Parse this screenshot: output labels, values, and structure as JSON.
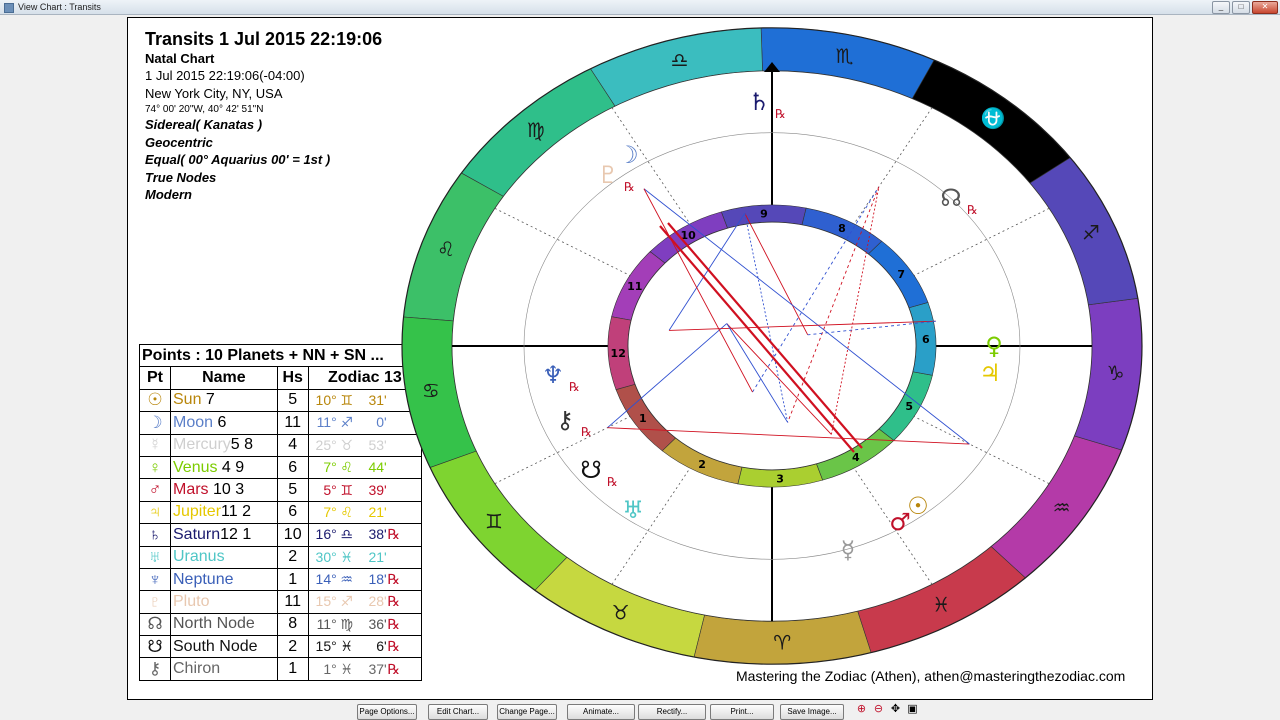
{
  "window": {
    "title": "View Chart : Transits"
  },
  "header": {
    "title": "Transits 1 Jul 2015 22:19:06",
    "chart_type": "Natal Chart",
    "datetime": "1 Jul 2015 22:19:06(-04:00)",
    "location": "New York City, NY, USA",
    "coords": "74° 00' 20\"W, 40° 42' 51\"N",
    "zodiac": "Sidereal( Kanatas )",
    "perspective": "Geocentric",
    "house_system": "Equal( 00° Aquarius 00' = 1st )",
    "nodes": "True Nodes",
    "style": "Modern"
  },
  "table": {
    "caption": "Points : 10 Planets + NN + SN ...",
    "headers": [
      "Pt",
      "Name",
      "Hs",
      "Zodiac 13"
    ],
    "rows": [
      {
        "glyph": "☉",
        "name": "Sun",
        "aspect": " 7",
        "hs": "5",
        "deg": "10°",
        "sign": "♊",
        "min": "31'",
        "rx": "",
        "color": "#b8860b"
      },
      {
        "glyph": "☽",
        "name": "Moon",
        "aspect": " 6",
        "hs": "11",
        "deg": "11°",
        "sign": "♐",
        "min": "0'",
        "rx": "",
        "color": "#5b7fc8"
      },
      {
        "glyph": "☿",
        "name": "Mercury",
        "aspect": "5 8",
        "hs": "4",
        "deg": "25°",
        "sign": "♉",
        "min": "53'",
        "rx": "",
        "color": "#cfcfcf"
      },
      {
        "glyph": "♀",
        "name": "Venus",
        "aspect": " 4  9",
        "hs": "6",
        "deg": "7°",
        "sign": "♌",
        "min": "44'",
        "rx": "",
        "color": "#7ccc00"
      },
      {
        "glyph": "♂",
        "name": "Mars",
        "aspect": " 10 3",
        "hs": "5",
        "deg": "5°",
        "sign": "♊",
        "min": "39'",
        "rx": "",
        "color": "#c0102a"
      },
      {
        "glyph": "♃",
        "name": "Jupiter",
        "aspect": "11 2",
        "hs": "6",
        "deg": "7°",
        "sign": "♌",
        "min": "21'",
        "rx": "",
        "color": "#e5c800"
      },
      {
        "glyph": "♄",
        "name": "Saturn",
        "aspect": "12 1",
        "hs": "10",
        "deg": "16°",
        "sign": "♎",
        "min": "38'",
        "rx": "℞",
        "color": "#1a1a6e"
      },
      {
        "glyph": "♅",
        "name": "Uranus",
        "aspect": "",
        "hs": "2",
        "deg": "30°",
        "sign": "♓",
        "min": "21'",
        "rx": "",
        "color": "#4fc6c6"
      },
      {
        "glyph": "♆",
        "name": "Neptune",
        "aspect": "",
        "hs": "1",
        "deg": "14°",
        "sign": "♒",
        "min": "18'",
        "rx": "℞",
        "color": "#3a5fb8"
      },
      {
        "glyph": "♇",
        "name": "Pluto",
        "aspect": "",
        "hs": "11",
        "deg": "15°",
        "sign": "♐",
        "min": "28'",
        "rx": "℞",
        "color": "#e8c8b0"
      },
      {
        "glyph": "☊",
        "name": "North Node",
        "aspect": "",
        "hs": "8",
        "deg": "11°",
        "sign": "♍",
        "min": "36'",
        "rx": "℞",
        "color": "#555555"
      },
      {
        "glyph": "☋",
        "name": "South Node",
        "aspect": "",
        "hs": "2",
        "deg": "15°",
        "sign": "♓",
        "min": "6'",
        "rx": "℞",
        "color": "#111111"
      },
      {
        "glyph": "⚷",
        "name": "Chiron",
        "aspect": "",
        "hs": "1",
        "deg": "1°",
        "sign": "♓",
        "min": "37'",
        "rx": "℞",
        "color": "#666666"
      }
    ]
  },
  "wheel": {
    "signs": [
      "♏",
      "♎",
      "♍",
      "♌",
      "♋",
      "♊",
      "♉",
      "♈",
      "♓",
      "♒",
      "♑",
      "♐",
      "⛎"
    ],
    "sign_colors": [
      "#1f6fd6",
      "#3bbdbf",
      "#2fbf8a",
      "#3cc068",
      "#35c24a",
      "#7ed430",
      "#c6d840",
      "#c2a43c",
      "#c83a4c",
      "#b43aa8",
      "#7c3ec0",
      "#5548b8",
      "#000000"
    ],
    "house_numbers": [
      "1",
      "2",
      "3",
      "4",
      "5",
      "6",
      "7",
      "8",
      "9",
      "10",
      "11",
      "12"
    ],
    "house_colors": [
      "#b0504a",
      "#c2a43c",
      "#aacf30",
      "#6ac548",
      "#2fbf8a",
      "#2a9fc8",
      "#1f6fd6",
      "#2f60d0",
      "#5548b8",
      "#7f3ec0",
      "#a33eb8",
      "#c0407a"
    ],
    "planets": [
      {
        "g": "♄",
        "c": "#1a1a6e",
        "rx": "℞"
      },
      {
        "g": "☽",
        "c": "#5b7fc8",
        "rx": ""
      },
      {
        "g": "♇",
        "c": "#e8c8b0",
        "rx": "℞"
      },
      {
        "g": "☊",
        "c": "#555555",
        "rx": "℞"
      },
      {
        "g": "♀",
        "c": "#7ccc00",
        "rx": ""
      },
      {
        "g": "♃",
        "c": "#e5c800",
        "rx": ""
      },
      {
        "g": "♆",
        "c": "#3a5fb8",
        "rx": "℞"
      },
      {
        "g": "⚷",
        "c": "#333333",
        "rx": "℞"
      },
      {
        "g": "☋",
        "c": "#111111",
        "rx": "℞"
      },
      {
        "g": "♅",
        "c": "#4fc6c6",
        "rx": ""
      },
      {
        "g": "☉",
        "c": "#b8860b",
        "rx": ""
      },
      {
        "g": "♂",
        "c": "#c0102a",
        "rx": ""
      },
      {
        "g": "☿",
        "c": "#9a9a9a",
        "rx": ""
      }
    ]
  },
  "credit": "Mastering the Zodiac (Athen), athen@masteringthezodiac.com",
  "buttons": [
    "Page Options...",
    "Edit Chart...",
    "Change Page...",
    "Animate...",
    "Rectify...",
    "Print...",
    "Save Image..."
  ],
  "zoom_icons": [
    "zoom-in",
    "zoom-out",
    "pan",
    "fit"
  ]
}
